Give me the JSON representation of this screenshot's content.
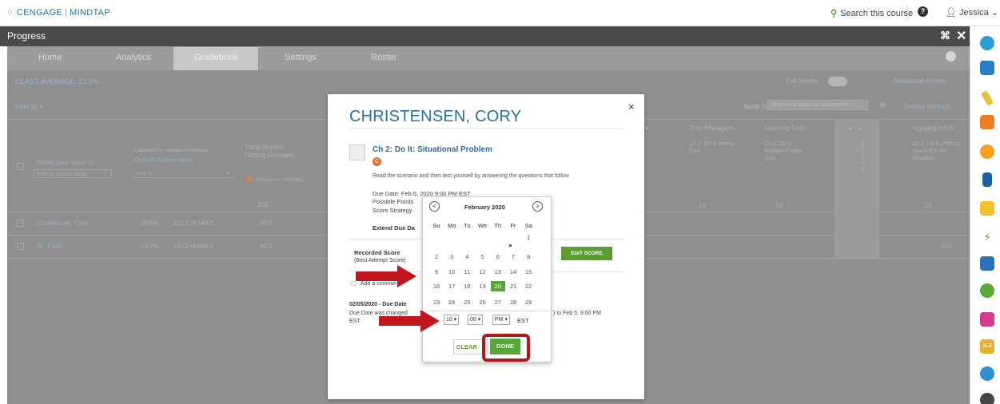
{
  "brand": {
    "logo_text": "CENGAGE",
    "logo_sep": "|",
    "logo_product": "MINDTAP"
  },
  "topbar": {
    "search_label": "Search this course",
    "help": "?",
    "user_label": "Jessica"
  },
  "panel": {
    "title": "Progress"
  },
  "tabs": [
    {
      "label": "Home"
    },
    {
      "label": "Analytics"
    },
    {
      "label": "Gradebook",
      "active": true
    },
    {
      "label": "Settings"
    },
    {
      "label": "Roster"
    }
  ],
  "gradebook": {
    "class_average": "CLASS AVERAGE: 21.3%",
    "edit_scores": "Edit Scores",
    "gradebook_actions": "Gradebook Actions",
    "filter_by": "Filter by",
    "jump_to": "Jump To:",
    "jump_placeholder": "Enter unit, folder or assignment",
    "display_settings": "Display Settings",
    "col_name": "Name",
    "col_name_sub": "(Show Student ID)",
    "filter_student": "Filter by Student Name",
    "calc_note": "Calculated by Average Percentage",
    "overall": "Overall Performance",
    "view_all": "View All",
    "think1": "Think Beyond",
    "think2": "Getting Licensed",
    "manual_grades": "MANUALLY GRADED",
    "points_100": "100",
    "time_mgmt": "Time Managem...",
    "learning_tools": "Learning Tools...",
    "applying": "Applying Healt",
    "ch2_media": "Ch 2: Do It: Media Quiz",
    "ch2_multi": "Ch 2: Do It: Multiple Choice Quiz",
    "ch2_putting": "Ch 2: Do It: Putting Yourself in the Situation",
    "life_skills": "Ch 2: Life Skills",
    "pts10": "10",
    "rows": [
      {
        "name": "Christensen, Cory",
        "pct": "20.5%",
        "score": "320.2 of 540.0",
        "val": "90.0"
      },
      {
        "name": "W., Faith",
        "pct": "19.0%",
        "score": "130.0 of 660.0",
        "val": "90.0",
        "last": "10.0"
      }
    ]
  },
  "modal": {
    "student_name": "CHRISTENSEN, CORY",
    "close": "×",
    "assignment_title": "Ch 2: Do It: Situational Problem",
    "badge": "C",
    "description": "Read the scenario and then test yourself by answering the questions that follow",
    "due_date": "Due Date: Feb 5, 2020 9:00 PM EST",
    "possible_points": "Possible Points",
    "score_strategy": "Score Strategy",
    "extend_due": "Extend Due Da",
    "recorded_score": "Recorded Score",
    "best_attempt": "(Best Attempt Score)",
    "edit_score_btn": "EDIT SCORE",
    "add_comment": "Add a comment",
    "log_date": "02/05/2020 - Due Date",
    "log_line1": "Due Date was changed",
    "log_line2": "EST",
    "log_tail": ") to Feb 5, 9:00 PM"
  },
  "calendar": {
    "prev": "<",
    "next": ">",
    "month": "February 2020",
    "dow": [
      "Su",
      "Mo",
      "Tu",
      "We",
      "Th",
      "Fr",
      "Sa"
    ],
    "weeks": [
      [
        "",
        "",
        "",
        "",
        "",
        "",
        "1"
      ],
      [
        "2",
        "3",
        "4",
        "5",
        "6",
        "7",
        "8"
      ],
      [
        "9",
        "10",
        "11",
        "12",
        "13",
        "14",
        "15"
      ],
      [
        "16",
        "17",
        "18",
        "19",
        "20",
        "21",
        "22"
      ],
      [
        "23",
        "24",
        "25",
        "26",
        "27",
        "28",
        "29"
      ]
    ],
    "selected_day": "20",
    "hour": "10 ▾",
    "minute": "00 ▾",
    "ampm": "PM ▾",
    "tz": "EST",
    "clear_btn": "CLEAR",
    "done_btn": "DONE"
  },
  "colors": {
    "brand_blue": "#2b6fa8",
    "accent_green": "#5aa53a",
    "highlight_red": "#b3161b",
    "arrow_red": "#c0181d"
  },
  "rail_icons": [
    "mindapp-icon",
    "briefcase-icon",
    "highlighter-icon",
    "rss-icon",
    "number-six-icon",
    "book-icon",
    "notepad-icon",
    "chart-spark-icon",
    "message-icon",
    "s-app-icon",
    "chat-icon",
    "a-z-dictionary-icon",
    "trend-icon",
    "search-app-icon"
  ]
}
